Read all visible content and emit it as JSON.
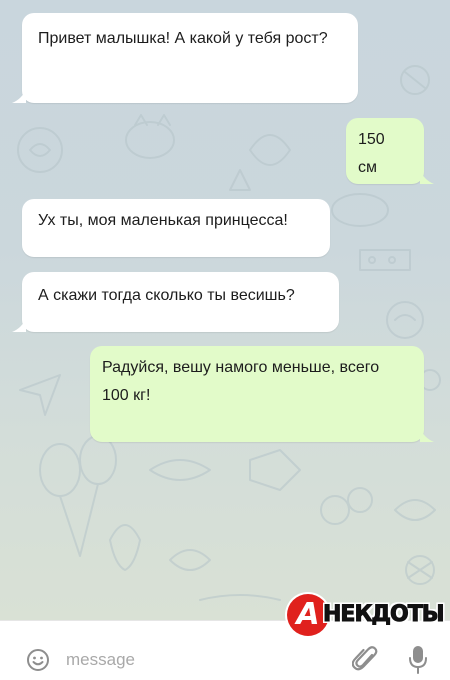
{
  "messages": [
    {
      "direction": "incoming",
      "text": "Привет малышка! А какой у тебя рост?"
    },
    {
      "direction": "outgoing",
      "text": "150 см"
    },
    {
      "direction": "incoming",
      "text": "Ух ты, моя маленькая принцесса!"
    },
    {
      "direction": "incoming",
      "text": "А скажи тогда сколько ты весишь?"
    },
    {
      "direction": "outgoing",
      "text": "Радуйся, вешу намого меньше, всего 100 кг!"
    }
  ],
  "colors": {
    "incoming_bubble": "#ffffff",
    "outgoing_bubble": "#e2fbc9",
    "chat_background": "#cbd7dc",
    "logo_red": "#e0211d"
  },
  "watermark": {
    "letter": "А",
    "text": "НЕКДОТЫ"
  },
  "input": {
    "placeholder": "message",
    "value": ""
  },
  "icons": {
    "emoji": "emoji-icon",
    "attach": "paperclip-icon",
    "mic": "microphone-icon"
  }
}
